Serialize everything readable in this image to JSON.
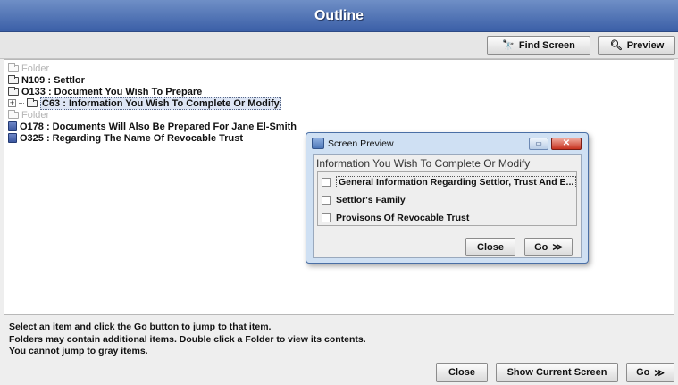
{
  "window": {
    "title": "Outline"
  },
  "toolbar": {
    "find_screen_label": "Find Screen",
    "find_screen_icon": "binoculars-icon",
    "preview_label": "Preview",
    "preview_icon": "magnifier-icon"
  },
  "tree": {
    "items": [
      {
        "label": "Folder",
        "icon": "folder-icon",
        "gray": true
      },
      {
        "label": "N109 : Settlor",
        "icon": "folder-icon",
        "gray": false
      },
      {
        "label": "O133 : Document You Wish To Prepare",
        "icon": "folder-icon",
        "gray": false
      },
      {
        "label": "C63 : Information You Wish To Complete Or Modify",
        "icon": "folder-icon",
        "gray": false,
        "selected": true,
        "expandable": true,
        "expander": "+"
      },
      {
        "label": "Folder",
        "icon": "folder-icon",
        "gray": true
      },
      {
        "label": "O178 : Documents Will Also Be Prepared For Jane El-Smith",
        "icon": "document-icon",
        "gray": false
      },
      {
        "label": "O325 : Regarding The Name Of Revocable Trust",
        "icon": "document-icon",
        "gray": false
      }
    ]
  },
  "info": {
    "line1": "Select an item and click the Go button to jump to that item.",
    "line2": "Folders may contain additional items. Double click a Folder to view its contents.",
    "line3": "You cannot jump to gray items."
  },
  "footer": {
    "close_label": "Close",
    "show_current_label": "Show Current Screen",
    "go_label": "Go",
    "go_arrow": "≫"
  },
  "dialog": {
    "title": "Screen Preview",
    "heading": "Information You Wish To Complete Or Modify",
    "options": [
      {
        "label": "General Information Regarding Settlor, Trust And E...",
        "checked": false
      },
      {
        "label": "Settlor's Family",
        "checked": false
      },
      {
        "label": "Provisons Of Revocable Trust",
        "checked": false
      }
    ],
    "close_label": "Close",
    "go_label": "Go",
    "go_arrow": "≫",
    "min_glyph": "▭",
    "close_glyph": "✕"
  }
}
